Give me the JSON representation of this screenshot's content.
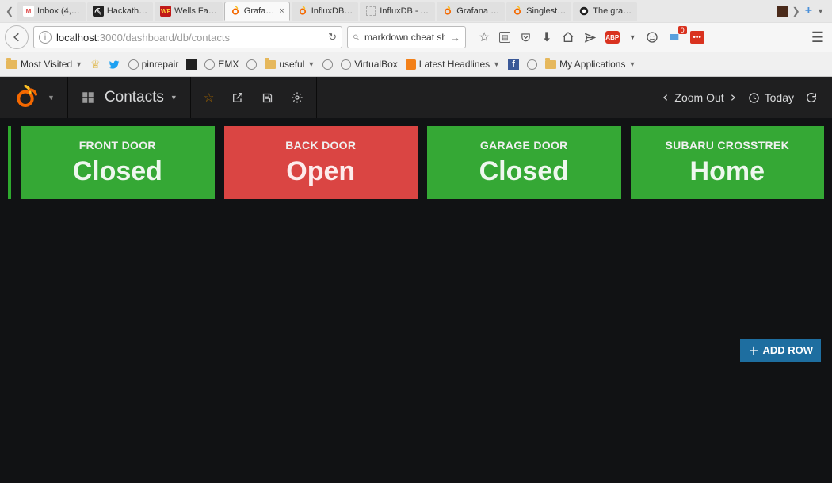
{
  "browser": {
    "tabs": [
      {
        "label": "Inbox (4,…",
        "icon_bg": "#fff",
        "icon_text": "M",
        "icon_color": "#d44"
      },
      {
        "label": "Hackath…",
        "icon_bg": "#222",
        "icon_text": "⛏",
        "icon_color": "#fff"
      },
      {
        "label": "Wells Fa…",
        "icon_bg": "#c01818",
        "icon_text": "WF",
        "icon_color": "#ffcf3f"
      },
      {
        "label": "Grafa…",
        "icon_bg": "transparent",
        "icon_text": "",
        "icon_color": "#f46800",
        "active": true
      },
      {
        "label": "InfluxDB…",
        "icon_bg": "transparent",
        "icon_text": "",
        "icon_color": "#f46800"
      },
      {
        "label": "InfluxDB - A…",
        "icon_bg": "transparent",
        "icon_text": "",
        "icon_color": "#999"
      },
      {
        "label": "Grafana …",
        "icon_bg": "transparent",
        "icon_text": "",
        "icon_color": "#f46800"
      },
      {
        "label": "Singlest…",
        "icon_bg": "transparent",
        "icon_text": "",
        "icon_color": "#f46800"
      },
      {
        "label": "The gra…",
        "icon_bg": "#fff",
        "icon_text": "",
        "icon_color": "#222"
      }
    ],
    "url_host": "localhost",
    "url_path": ":3000/dashboard/db/contacts",
    "search_value": "markdown cheat she",
    "notif_badge": "0"
  },
  "bookmarks": [
    {
      "label": "Most Visited",
      "icon": "folder",
      "caret": true
    },
    {
      "label": "",
      "icon": "crest"
    },
    {
      "label": "",
      "icon": "twitter"
    },
    {
      "label": "pinrepair",
      "icon": "globe"
    },
    {
      "label": "",
      "icon": "sq"
    },
    {
      "label": "EMX",
      "icon": "globe"
    },
    {
      "label": "",
      "icon": "globe_only"
    },
    {
      "label": "useful",
      "icon": "folder",
      "caret": true
    },
    {
      "label": "",
      "icon": "globe_only"
    },
    {
      "label": "VirtualBox",
      "icon": "globe"
    },
    {
      "label": "Latest Headlines",
      "icon": "rss",
      "caret": true
    },
    {
      "label": "",
      "icon": "fb"
    },
    {
      "label": "",
      "icon": "globe_only"
    },
    {
      "label": "My Applications",
      "icon": "folder",
      "caret": true
    }
  ],
  "grafana": {
    "dashboard_title": "Contacts",
    "zoom_label": "Zoom Out",
    "time_label": "Today",
    "add_row_label": "ADD ROW",
    "panels": [
      {
        "title": "FRONT DOOR",
        "value": "Closed",
        "status": "green"
      },
      {
        "title": "BACK DOOR",
        "value": "Open",
        "status": "red"
      },
      {
        "title": "GARAGE DOOR",
        "value": "Closed",
        "status": "green"
      },
      {
        "title": "SUBARU CROSSTREK",
        "value": "Home",
        "status": "green"
      }
    ]
  }
}
